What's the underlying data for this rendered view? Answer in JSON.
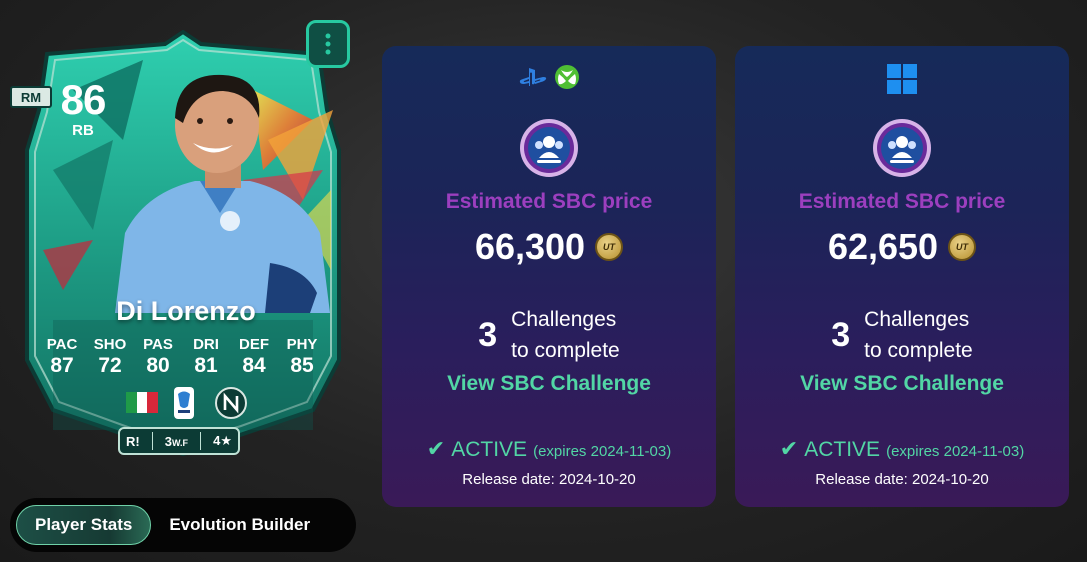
{
  "card": {
    "position_badge": "RM",
    "rating": "86",
    "alt_position": "RB",
    "name": "Di Lorenzo",
    "stats": [
      {
        "label": "PAC",
        "value": "87"
      },
      {
        "label": "SHO",
        "value": "72"
      },
      {
        "label": "PAS",
        "value": "80"
      },
      {
        "label": "DRI",
        "value": "81"
      },
      {
        "label": "DEF",
        "value": "84"
      },
      {
        "label": "PHY",
        "value": "85"
      }
    ],
    "footer": {
      "role": "R!",
      "weak_foot": "3",
      "weak_foot_suffix": "W.F",
      "skill": "4★"
    },
    "colors": {
      "base": "#1fb89a",
      "border": "#27c9a1",
      "accent": "#f2a23a"
    }
  },
  "tabs": [
    {
      "label": "Player Stats",
      "active": true
    },
    {
      "label": "Evolution Builder",
      "active": false
    }
  ],
  "panels": [
    {
      "platform_icons": [
        "playstation-icon",
        "xbox-icon"
      ],
      "price_label": "Estimated SBC price",
      "price": "66,300",
      "coin_text": "UT",
      "challenges_count": "3",
      "challenges_line1": "Challenges",
      "challenges_line2": "to complete",
      "link_label": "View SBC Challenge",
      "status_check": "✔",
      "status": "ACTIVE",
      "expires": "(expires 2024-11-03)",
      "release": "Release date: 2024-10-20"
    },
    {
      "platform_icons": [
        "windows-icon"
      ],
      "price_label": "Estimated SBC price",
      "price": "62,650",
      "coin_text": "UT",
      "challenges_count": "3",
      "challenges_line1": "Challenges",
      "challenges_line2": "to complete",
      "link_label": "View SBC Challenge",
      "status_check": "✔",
      "status": "ACTIVE",
      "expires": "(expires 2024-11-03)",
      "release": "Release date: 2024-10-20"
    }
  ],
  "colors": {
    "price_label": "#9c3fbf",
    "link": "#52d6a5",
    "panel_top": "#162a59",
    "panel_bottom": "#3a1a58"
  }
}
